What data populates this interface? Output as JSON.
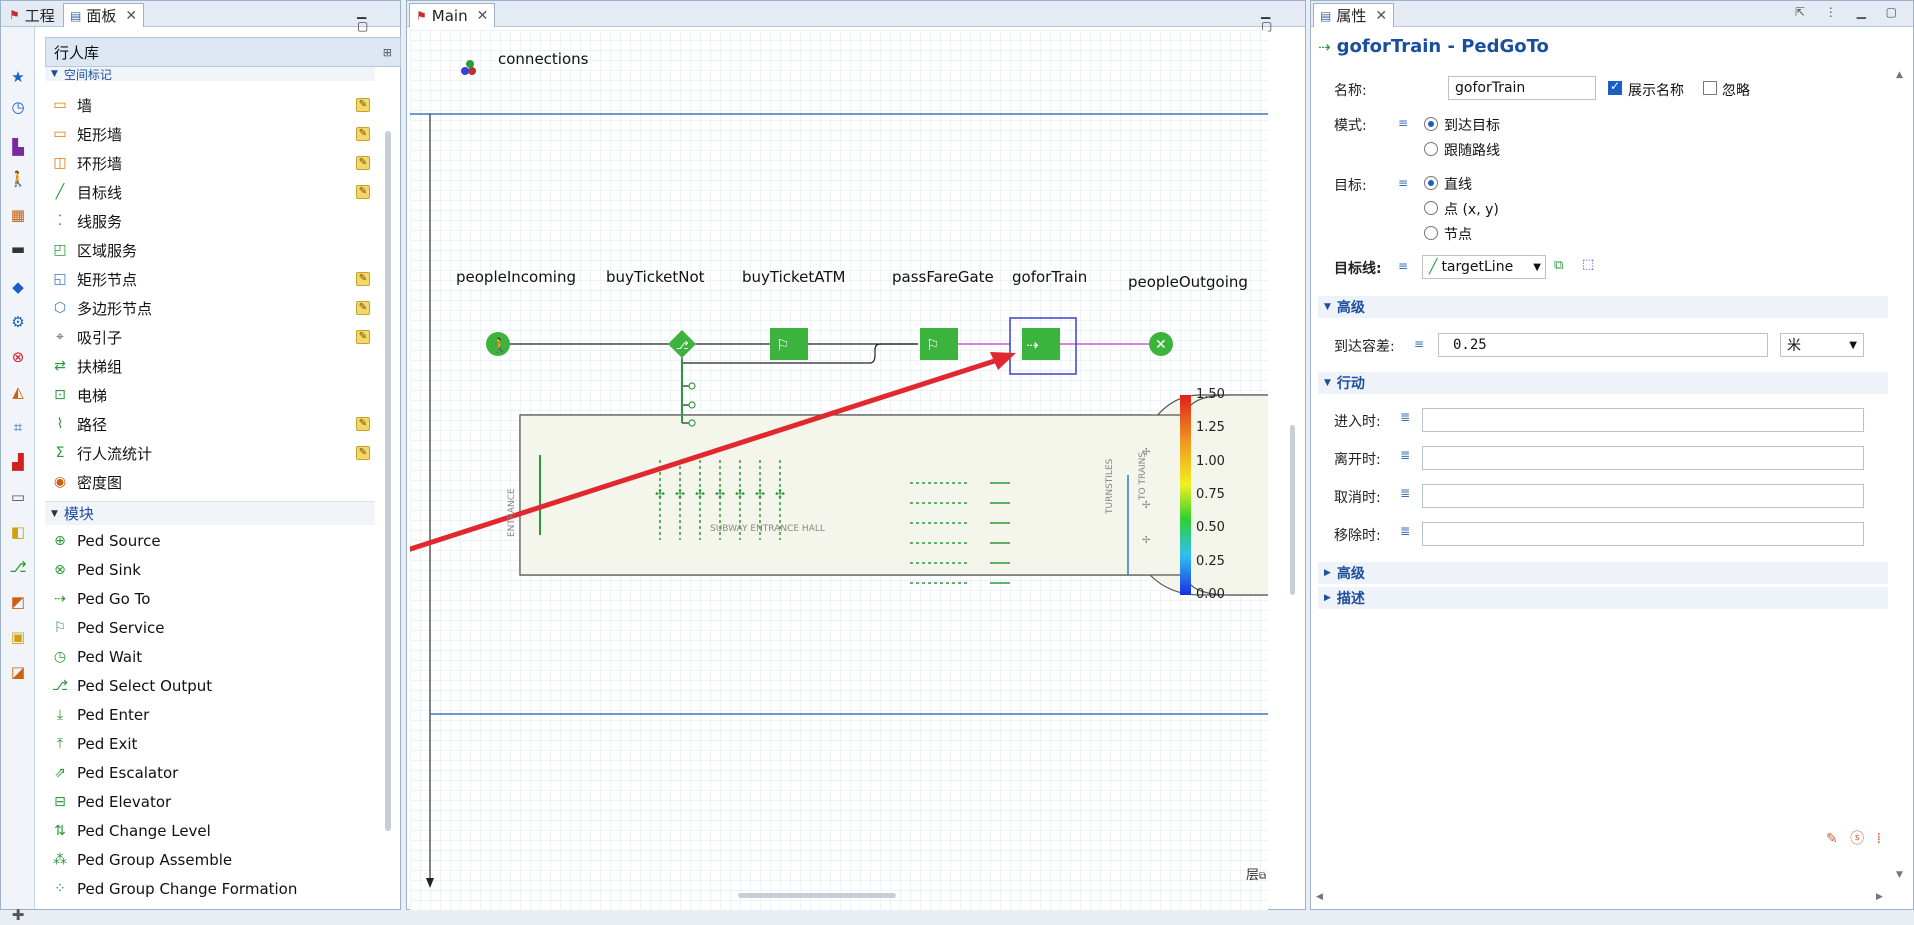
{
  "left_panel": {
    "tabs": [
      {
        "label": "工程"
      },
      {
        "label": "面板"
      }
    ],
    "library_title": "行人库",
    "space_group_label": "空间标记",
    "space_items": [
      {
        "label": "墙",
        "icon": "wall-icon"
      },
      {
        "label": "矩形墙",
        "icon": "rect-wall-icon"
      },
      {
        "label": "环形墙",
        "icon": "ring-wall-icon"
      },
      {
        "label": "目标线",
        "icon": "target-line-icon"
      },
      {
        "label": "线服务",
        "icon": "line-service-icon"
      },
      {
        "label": "区域服务",
        "icon": "area-service-icon"
      },
      {
        "label": "矩形节点",
        "icon": "rect-node-icon"
      },
      {
        "label": "多边形节点",
        "icon": "polygon-node-icon"
      },
      {
        "label": "吸引子",
        "icon": "attractor-icon"
      },
      {
        "label": "扶梯组",
        "icon": "escalator-group-icon"
      },
      {
        "label": "电梯",
        "icon": "elevator-icon"
      },
      {
        "label": "路径",
        "icon": "path-icon"
      },
      {
        "label": "行人流统计",
        "icon": "ped-flow-stats-icon"
      },
      {
        "label": "密度图",
        "icon": "density-map-icon"
      }
    ],
    "module_group_label": "模块",
    "modules": [
      {
        "label": "Ped Source"
      },
      {
        "label": "Ped Sink"
      },
      {
        "label": "Ped Go To"
      },
      {
        "label": "Ped Service"
      },
      {
        "label": "Ped Wait"
      },
      {
        "label": "Ped Select Output"
      },
      {
        "label": "Ped Enter"
      },
      {
        "label": "Ped Exit"
      },
      {
        "label": "Ped Escalator"
      },
      {
        "label": "Ped Elevator"
      },
      {
        "label": "Ped Change Level"
      },
      {
        "label": "Ped Group Assemble"
      },
      {
        "label": "Ped Group Change Formation"
      }
    ]
  },
  "main_panel": {
    "tab_label": "Main",
    "connections_label": "connections",
    "blocks": [
      {
        "label": "peopleIncoming"
      },
      {
        "label": "buyTicketNot"
      },
      {
        "label": "buyTicketATM"
      },
      {
        "label": "passFareGate"
      },
      {
        "label": "goforTrain"
      },
      {
        "label": "peopleOutgoing"
      }
    ],
    "hall_label": "SUBWAY ENTRANCE HALL",
    "entrance_label": "ENTRANCE",
    "turnstiles_label": "TURNSTILES",
    "to_trains_label": "TO TRAINS",
    "legend_values": [
      "1.50",
      "1.25",
      "1.00",
      "0.75",
      "0.50",
      "0.25",
      "0.00"
    ],
    "layer_button_label": "层"
  },
  "properties": {
    "tab_label": "属性",
    "title": "goforTrain - PedGoTo",
    "name_label": "名称:",
    "name_value": "goforTrain",
    "show_name_label": "展示名称",
    "show_name_checked": true,
    "ignore_label": "忽略",
    "ignore_checked": false,
    "mode_label": "模式:",
    "mode_options": [
      "到达目标",
      "跟随路线"
    ],
    "target_label": "目标:",
    "target_options": [
      "直线",
      "点 (x, y)",
      "节点"
    ],
    "target_line_label": "目标线:",
    "target_line_value": "targetLine",
    "advanced_label": "高级",
    "tolerance_label": "到达容差:",
    "tolerance_value": "0.25",
    "tolerance_unit": "米",
    "actions_label": "行动",
    "on_enter_label": "进入时:",
    "on_exit_label": "离开时:",
    "on_cancel_label": "取消时:",
    "on_remove_label": "移除时:",
    "advanced2_label": "高级",
    "description_label": "描述"
  },
  "colors": {
    "accent": "#1a5fc4",
    "block_green": "#3cb33c",
    "arrow_red": "#e0282e",
    "flow_magenta": "#c03cc0"
  }
}
